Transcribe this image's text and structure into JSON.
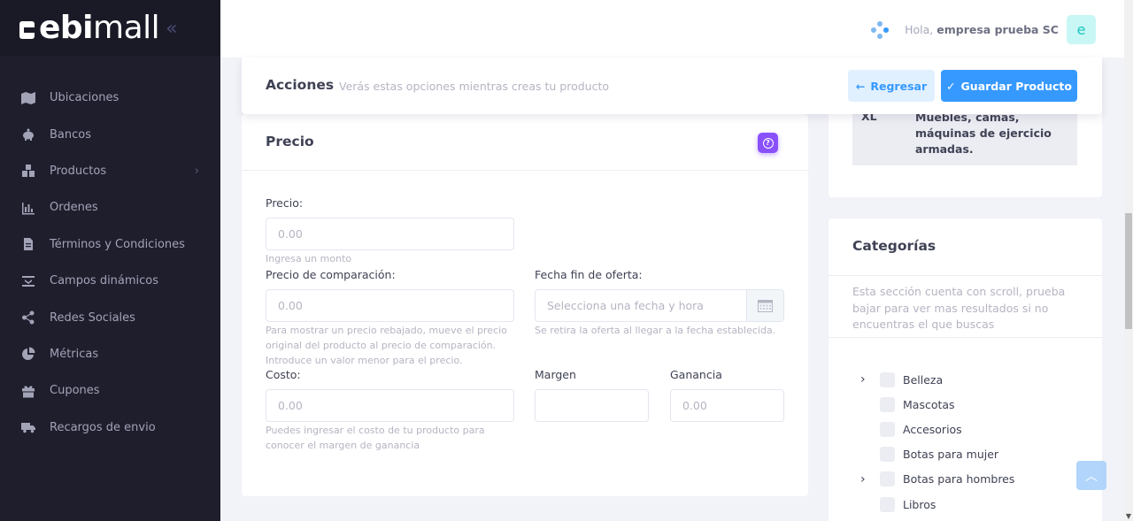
{
  "brand": {
    "name_bold": "ebi",
    "name_light": "mall",
    "collapse_icon": "double-chevron-left-icon"
  },
  "sidebar": {
    "items": [
      {
        "label": "Ubicaciones",
        "icon": "map-icon"
      },
      {
        "label": "Bancos",
        "icon": "piggy-bank-icon"
      },
      {
        "label": "Productos",
        "icon": "boxes-icon",
        "has_submenu": true
      },
      {
        "label": "Ordenes",
        "icon": "bar-chart-icon"
      },
      {
        "label": "Términos y Condiciones",
        "icon": "document-icon"
      },
      {
        "label": "Campos dinámicos",
        "icon": "fields-icon"
      },
      {
        "label": "Redes Sociales",
        "icon": "share-icon"
      },
      {
        "label": "Métricas",
        "icon": "pie-chart-icon"
      },
      {
        "label": "Cupones",
        "icon": "gift-icon"
      },
      {
        "label": "Recargos de envio",
        "icon": "truck-icon"
      }
    ]
  },
  "header": {
    "greeting": "Hola,",
    "user_name": "empresa prueba SC",
    "avatar_letter": "e"
  },
  "actions": {
    "title": "Acciones",
    "subtitle": "Verás estas opciones mientras creas tu producto",
    "back_label": "Regresar",
    "save_label": "Guardar Producto"
  },
  "price": {
    "title": "Precio",
    "precio_label": "Precio:",
    "precio_placeholder": "0.00",
    "precio_hint": "Ingresa un monto",
    "comparacion_label": "Precio de comparación:",
    "comparacion_placeholder": "0.00",
    "comparacion_hint_1": "Para mostrar un precio rebajado, mueve el precio",
    "comparacion_hint_2": "original del producto al precio de comparación.",
    "comparacion_hint_3": "Introduce un valor menor para el precio.",
    "fecha_label": "Fecha fin de oferta:",
    "fecha_placeholder": "Selecciona una fecha y hora",
    "fecha_hint": "Se retira la oferta al llegar a la fecha establecida.",
    "costo_label": "Costo:",
    "costo_placeholder": "0.00",
    "costo_hint_1": "Puedes ingresar el costo de tu producto para",
    "costo_hint_2": "conocer el margen de ganancia",
    "margen_label": "Margen",
    "margen_value": "",
    "ganancia_label": "Ganancia",
    "ganancia_placeholder": "0.00"
  },
  "size": {
    "code": "XL",
    "description_lines": [
      "Muebles, camas,",
      "máquinas de ejercicio",
      "armadas."
    ]
  },
  "categories": {
    "title": "Categorías",
    "note": "Esta sección cuenta con scroll, prueba bajar para ver mas resultados si no encuentras el que buscas",
    "items": [
      {
        "label": "Belleza",
        "expandable": true
      },
      {
        "label": "Mascotas",
        "expandable": false
      },
      {
        "label": "Accesorios",
        "expandable": false
      },
      {
        "label": "Botas para mujer",
        "expandable": false
      },
      {
        "label": "Botas para hombres",
        "expandable": true
      },
      {
        "label": "Libros",
        "expandable": false
      }
    ]
  },
  "colors": {
    "primary": "#3699ff",
    "primary_light": "#e1f0ff",
    "sidebar_bg": "#1e1e2d",
    "help": "#8950fc"
  }
}
